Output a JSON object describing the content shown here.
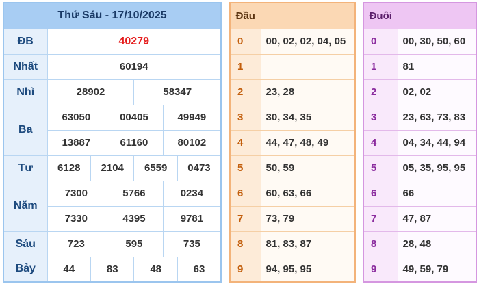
{
  "results": {
    "title": "Thứ Sáu - 17/10/2025",
    "db": {
      "label": "ĐB",
      "value": "40279"
    },
    "nhat": {
      "label": "Nhất",
      "values": [
        "60194"
      ]
    },
    "nhi": {
      "label": "Nhì",
      "values": [
        "28902",
        "58347"
      ]
    },
    "ba": {
      "label": "Ba",
      "values": [
        "63050",
        "00405",
        "49949",
        "13887",
        "61160",
        "80102"
      ]
    },
    "tu": {
      "label": "Tư",
      "values": [
        "6128",
        "2104",
        "6559",
        "0473"
      ]
    },
    "nam": {
      "label": "Năm",
      "values": [
        "7300",
        "5766",
        "0234",
        "7330",
        "4395",
        "9781"
      ]
    },
    "sau": {
      "label": "Sáu",
      "values": [
        "723",
        "595",
        "735"
      ]
    },
    "bay": {
      "label": "Bảy",
      "values": [
        "44",
        "83",
        "48",
        "63"
      ]
    }
  },
  "head": {
    "title": "Đầu",
    "rows": [
      {
        "digit": "0",
        "values": "00, 02, 02, 04, 05"
      },
      {
        "digit": "1",
        "values": ""
      },
      {
        "digit": "2",
        "values": "23, 28"
      },
      {
        "digit": "3",
        "values": "30, 34, 35"
      },
      {
        "digit": "4",
        "values": "44, 47, 48, 49"
      },
      {
        "digit": "5",
        "values": "50, 59"
      },
      {
        "digit": "6",
        "values": "60, 63, 66"
      },
      {
        "digit": "7",
        "values": "73, 79"
      },
      {
        "digit": "8",
        "values": "81, 83, 87"
      },
      {
        "digit": "9",
        "values": "94, 95, 95"
      }
    ]
  },
  "tail": {
    "title": "Đuôi",
    "rows": [
      {
        "digit": "0",
        "values": "00, 30, 50, 60"
      },
      {
        "digit": "1",
        "values": "81"
      },
      {
        "digit": "2",
        "values": "02, 02"
      },
      {
        "digit": "3",
        "values": "23, 63, 73, 83"
      },
      {
        "digit": "4",
        "values": "04, 34, 44, 94"
      },
      {
        "digit": "5",
        "values": "05, 35, 95, 95"
      },
      {
        "digit": "6",
        "values": "66"
      },
      {
        "digit": "7",
        "values": "47, 87"
      },
      {
        "digit": "8",
        "values": "28, 48"
      },
      {
        "digit": "9",
        "values": "49, 59, 79"
      }
    ]
  },
  "colors": {
    "results_header": "#a8cdf3",
    "special_prize": "#e51e1e",
    "head_header": "#fbd8b4",
    "head_digit": "#c25e0c",
    "tail_header": "#eec6f3",
    "tail_digit": "#8b2c9e"
  }
}
